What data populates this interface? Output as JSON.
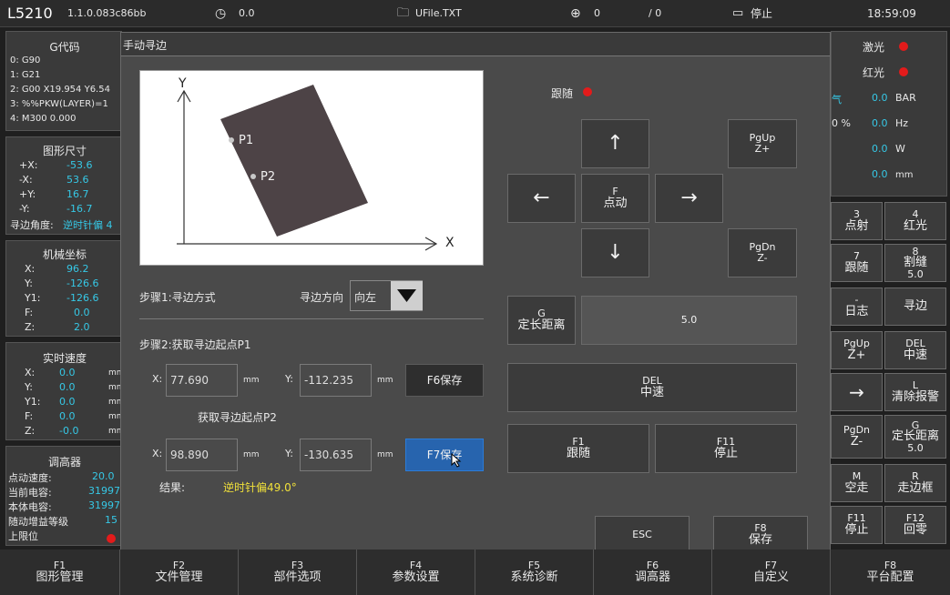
{
  "topbar": {
    "model": "L5210",
    "version": "1.1.0.083c86bb",
    "timer_value": "0.0",
    "file_name": "UFile.TXT",
    "target_value": "0",
    "count": "/ 0",
    "status": "停止",
    "clock": "18:59:09"
  },
  "gcode": {
    "title": "G代码",
    "lines": [
      "0: G90",
      "1: G21",
      "2: G00 X19.954 Y6.54",
      "3: %%PKW(LAYER)=1",
      "4: M300 0.000"
    ]
  },
  "shape_size": {
    "title": "图形尺寸",
    "rows": [
      {
        "label": "+X:",
        "value": "-53.6"
      },
      {
        "label": "-X:",
        "value": "53.6"
      },
      {
        "label": "+Y:",
        "value": "16.7"
      },
      {
        "label": "-Y:",
        "value": "-16.7"
      }
    ],
    "angle_label": "寻边角度:",
    "angle_value": "逆时针偏 4"
  },
  "machine_coord": {
    "title": "机械坐标",
    "rows": [
      {
        "label": "X:",
        "value": "96.2"
      },
      {
        "label": "Y:",
        "value": "-126.6"
      },
      {
        "label": "Y1:",
        "value": "-126.6"
      },
      {
        "label": "F:",
        "value": "0.0"
      },
      {
        "label": "Z:",
        "value": "2.0"
      }
    ]
  },
  "realtime_speed": {
    "title": "实时速度",
    "unit": "mm",
    "rows": [
      {
        "label": "X:",
        "value": "0.0"
      },
      {
        "label": "Y:",
        "value": "0.0"
      },
      {
        "label": "Y1:",
        "value": "0.0"
      },
      {
        "label": "F:",
        "value": "0.0"
      },
      {
        "label": "Z:",
        "value": "-0.0"
      }
    ]
  },
  "height_ctrl": {
    "title": "调高器",
    "rows": [
      {
        "label": "点动速度:",
        "value": "20.0"
      },
      {
        "label": "当前电容:",
        "value": "31997"
      },
      {
        "label": "本体电容:",
        "value": "31997"
      },
      {
        "label": "随动增益等级",
        "value": "15"
      },
      {
        "label": "上限位",
        "value": ""
      }
    ]
  },
  "right_status": {
    "laser_label": "激光",
    "redlight_label": "红光",
    "rows": [
      {
        "prefix": "气",
        "value": "0.0",
        "unit": "BAR"
      },
      {
        "prefix": "0 %",
        "value": "0.0",
        "unit": "Hz"
      },
      {
        "prefix": "",
        "value": "0.0",
        "unit": "W"
      },
      {
        "prefix": "",
        "value": "0.0",
        "unit": "mm"
      }
    ]
  },
  "right_buttons": [
    {
      "key": "3",
      "label": "点射",
      "sub": ""
    },
    {
      "key": "4",
      "label": "红光",
      "sub": ""
    },
    {
      "key": "7",
      "label": "跟随",
      "sub": ""
    },
    {
      "key": "8",
      "label": "割缝",
      "sub": "5.0"
    },
    {
      "key": "-",
      "label": "日志",
      "sub": ""
    },
    {
      "key": "",
      "label": "寻边",
      "sub": ""
    },
    {
      "key": "PgUp",
      "label": "Z+",
      "sub": ""
    },
    {
      "key": "DEL",
      "label": "中速",
      "sub": ""
    },
    {
      "key": "",
      "label": "→",
      "sub": ""
    },
    {
      "key": "L",
      "label": "清除报警",
      "sub": ""
    },
    {
      "key": "PgDn",
      "label": "Z-",
      "sub": ""
    },
    {
      "key": "G",
      "label": "定长距离",
      "sub": "5.0"
    },
    {
      "key": "M",
      "label": "空走",
      "sub": ""
    },
    {
      "key": "R",
      "label": "走边框",
      "sub": ""
    },
    {
      "key": "F11",
      "label": "停止",
      "sub": ""
    },
    {
      "key": "F12",
      "label": "回零",
      "sub": ""
    }
  ],
  "dialog": {
    "title": "手动寻边",
    "diagram": {
      "y_label": "Y",
      "x_label": "X",
      "p1_label": "P1",
      "p2_label": "P2"
    },
    "step1_label": "步骤1:寻边方式",
    "direction_label": "寻边方向",
    "direction_value": "向左",
    "step2_label": "步骤2:获取寻边起点P1",
    "p1": {
      "x_label": "X:",
      "x_value": "77.690",
      "x_unit": "mm",
      "y_label": "Y:",
      "y_value": "-112.235",
      "y_unit": "mm",
      "save": "F6保存"
    },
    "p2_label": "获取寻边起点P2",
    "p2": {
      "x_label": "X:",
      "x_value": "98.890",
      "x_unit": "mm",
      "y_label": "Y:",
      "y_value": "-130.635",
      "y_unit": "mm",
      "save": "F7保存"
    },
    "result_label": "结果:",
    "result_value": "逆时针偏49.0°",
    "follow_label": "跟随",
    "jog": {
      "up": "↑",
      "down": "↓",
      "left": "←",
      "right": "→",
      "center_key": "F",
      "center_label": "点动"
    },
    "pgup": {
      "key": "PgUp",
      "label": "Z+"
    },
    "pgdn": {
      "key": "PgDn",
      "label": "Z-"
    },
    "fixed_len": {
      "key": "G",
      "label": "定长距离",
      "value": "5.0"
    },
    "speed": {
      "key": "DEL",
      "label": "中速"
    },
    "follow_btn": {
      "key": "F1",
      "label": "跟随"
    },
    "stop_btn": {
      "key": "F11",
      "label": "停止"
    },
    "esc": "ESC",
    "save_btn": {
      "key": "F8",
      "label": "保存"
    }
  },
  "bottom": [
    {
      "key": "F1",
      "label": "图形管理"
    },
    {
      "key": "F2",
      "label": "文件管理"
    },
    {
      "key": "F3",
      "label": "部件选项"
    },
    {
      "key": "F4",
      "label": "参数设置"
    },
    {
      "key": "F5",
      "label": "系统诊断"
    },
    {
      "key": "F6",
      "label": "调高器"
    },
    {
      "key": "F7",
      "label": "自定义"
    },
    {
      "key": "F8",
      "label": "平台配置"
    }
  ]
}
